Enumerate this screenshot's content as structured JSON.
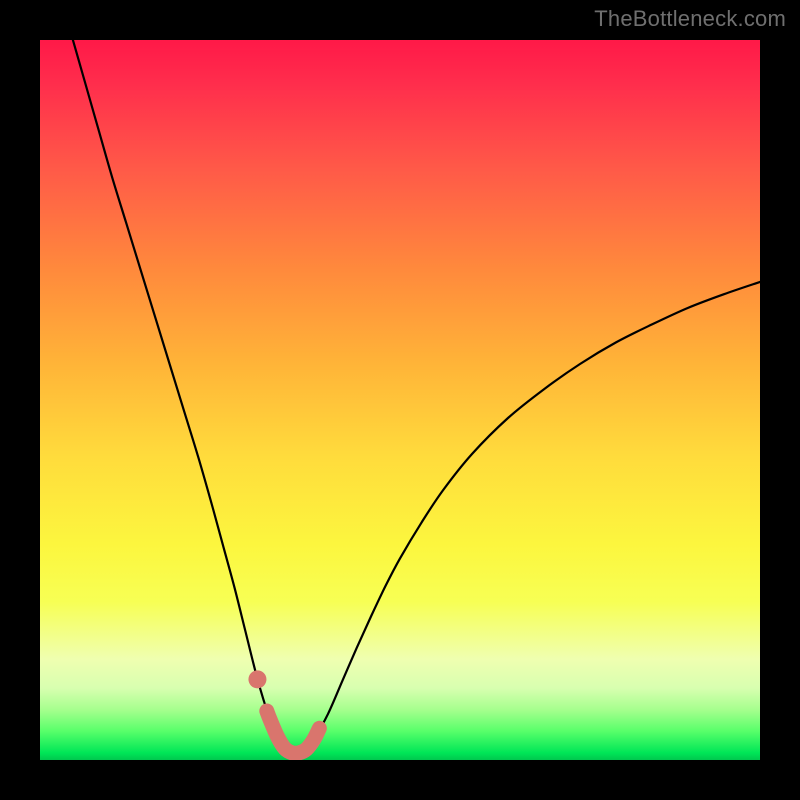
{
  "watermark": "TheBottleneck.com",
  "colors": {
    "background": "#000000",
    "curve": "#000000",
    "highlight": "#d9756d",
    "highlight_dot": "#d9756d",
    "gradient_top": "#ff1948",
    "gradient_mid": "#fff23a",
    "gradient_bottom": "#00c84e"
  },
  "chart_data": {
    "type": "line",
    "title": "",
    "subtitle": "",
    "xlabel": "",
    "ylabel": "",
    "xlim": [
      0,
      100
    ],
    "ylim": [
      0,
      100
    ],
    "grid": false,
    "legend": "none",
    "annotations": [],
    "series": [
      {
        "name": "main-curve",
        "color": "#000000",
        "x": [
          4,
          6,
          8,
          10,
          12,
          14,
          16,
          18,
          20,
          22,
          24,
          25.5,
          27,
          28.5,
          30,
          31,
          32,
          33,
          34,
          35,
          36,
          37,
          38,
          40,
          42,
          44,
          46,
          48,
          50,
          53,
          56,
          60,
          65,
          70,
          75,
          80,
          85,
          90,
          95,
          100
        ],
        "y": [
          102,
          95,
          88,
          81,
          74.5,
          68,
          61.5,
          55,
          48.5,
          42,
          35,
          29.5,
          24,
          18,
          12,
          8.5,
          5.5,
          3.2,
          1.6,
          1.0,
          1.0,
          1.5,
          2.8,
          6.4,
          11.0,
          15.6,
          20.0,
          24.2,
          28.0,
          33.0,
          37.5,
          42.5,
          47.5,
          51.5,
          55.0,
          58.0,
          60.5,
          62.8,
          64.7,
          66.4
        ]
      },
      {
        "name": "highlight-segment",
        "color": "#d9756d",
        "x": [
          31.5,
          32,
          33,
          34,
          35,
          36,
          37,
          38,
          38.8
        ],
        "y": [
          6.8,
          5.5,
          3.2,
          1.6,
          1.0,
          1.0,
          1.5,
          2.8,
          4.4
        ]
      },
      {
        "name": "highlight-dot",
        "color": "#d9756d",
        "x": [
          30.2
        ],
        "y": [
          11.2
        ]
      }
    ]
  }
}
